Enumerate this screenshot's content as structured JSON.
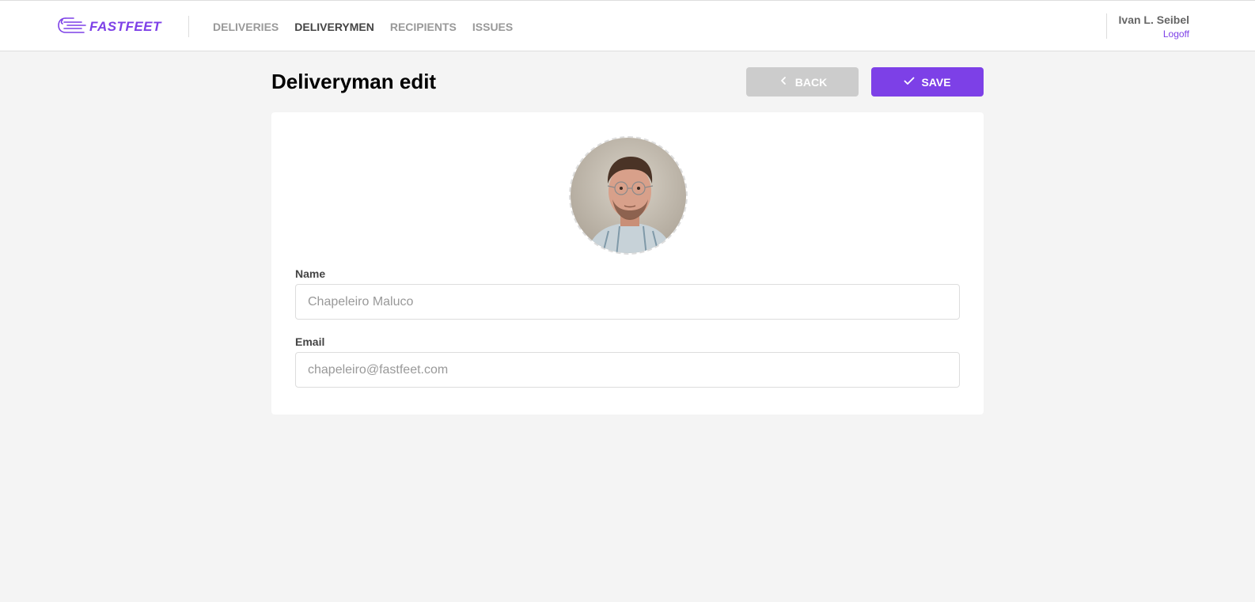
{
  "header": {
    "brand": "FASTFEET",
    "nav": [
      {
        "label": "DELIVERIES",
        "active": false
      },
      {
        "label": "DELIVERYMEN",
        "active": true
      },
      {
        "label": "RECIPIENTS",
        "active": false
      },
      {
        "label": "ISSUES",
        "active": false
      }
    ],
    "user_name": "Ivan L. Seibel",
    "logoff_label": "Logoff"
  },
  "page": {
    "title": "Deliveryman edit",
    "back_label": "BACK",
    "save_label": "SAVE"
  },
  "form": {
    "name_label": "Name",
    "name_value": "Chapeleiro Maluco",
    "email_label": "Email",
    "email_value": "chapeleiro@fastfeet.com"
  },
  "colors": {
    "accent": "#7d40e7",
    "back_button": "#cccccc",
    "background": "#f4f4f4"
  },
  "icons": {
    "back": "chevron-left-icon",
    "save": "check-icon",
    "logo": "fast-truck-icon"
  }
}
